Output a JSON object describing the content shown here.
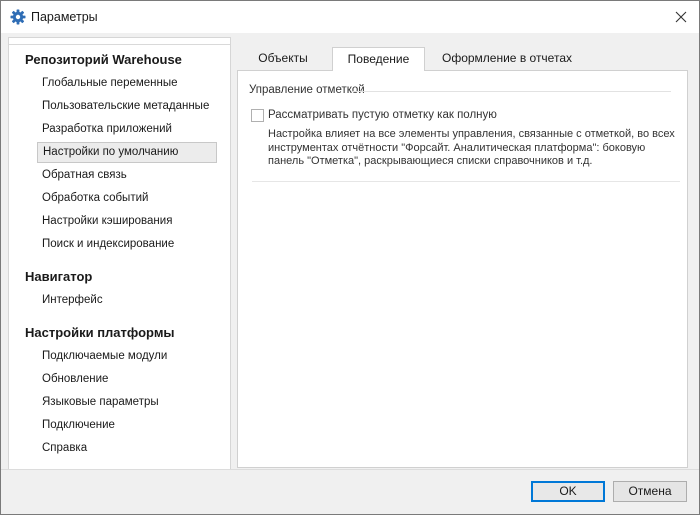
{
  "window": {
    "title": "Параметры"
  },
  "nav": {
    "sections": [
      {
        "title": "Репозиторий Warehouse",
        "items": [
          "Глобальные переменные",
          "Пользовательские метаданные",
          "Разработка приложений",
          "Настройки по умолчанию",
          "Обратная связь",
          "Обработка событий",
          "Настройки кэширования",
          "Поиск и индексирование"
        ]
      },
      {
        "title": "Навигатор",
        "items": [
          "Интерфейс"
        ]
      },
      {
        "title": "Настройки платформы",
        "items": [
          "Подключаемые модули",
          "Обновление",
          "Языковые параметры",
          "Подключение",
          "Справка"
        ]
      }
    ],
    "selected_item": "Настройки по умолчанию"
  },
  "tabs": {
    "objects": "Объекты",
    "behavior": "Поведение",
    "report_design": "Оформление в отчетах",
    "active": "Поведение"
  },
  "panel": {
    "group_title": "Управление отметкой",
    "checkbox_label": "Рассматривать пустую отметку как полную",
    "checkbox_checked": false,
    "description": "Настройка влияет на все элементы управления, связанные с отметкой, во всех инструментах отчётности \"Форсайт. Аналитическая платформа\": боковую панель \"Отметка\", раскрывающиеся списки справочников и т.д."
  },
  "buttons": {
    "ok": "OK",
    "cancel": "Отмена"
  },
  "colors": {
    "accent": "#0078d7",
    "icon": "#2f6db5"
  }
}
